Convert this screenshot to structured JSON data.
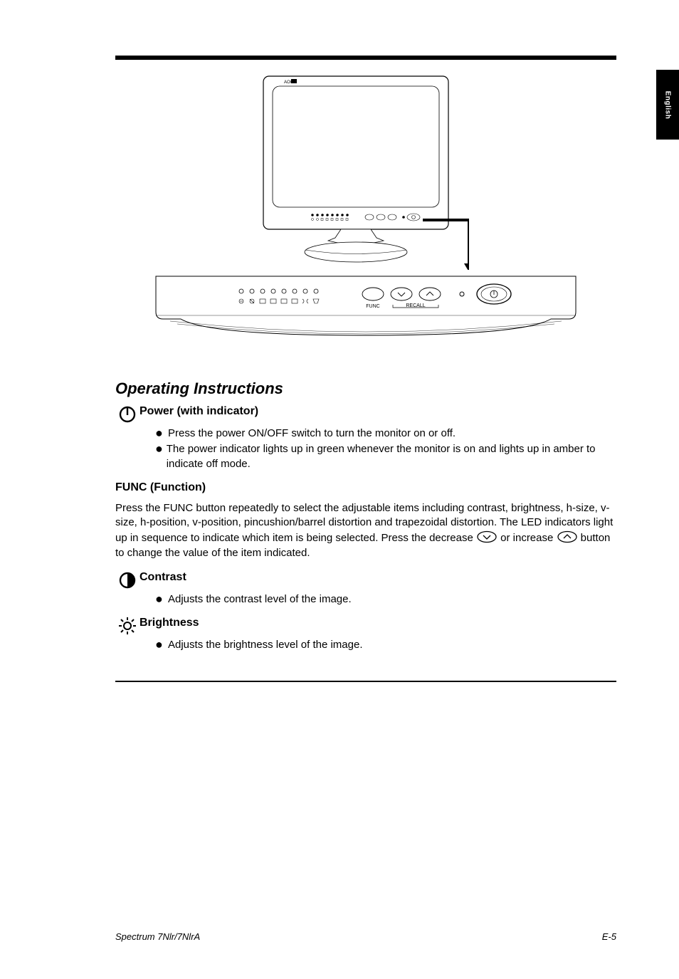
{
  "sidebar": {
    "label": "English"
  },
  "figure": {
    "monitor_brand": "AOC",
    "panel_label_func": "FUNC",
    "panel_label_recall": "RECALL"
  },
  "sections": {
    "operating": {
      "heading": "Operating Instructions",
      "power_label": "Power (with indicator)",
      "bullets": [
        "Press the power ON/OFF switch to turn the monitor on or off.",
        "The power indicator lights up in green whenever the monitor is on and lights up in amber to indicate off mode."
      ],
      "func_label": "FUNC (Function)",
      "func_para": "Press the FUNC button repeatedly to select the adjustable items including contrast, brightness, h-size, v-size, h-position, v-position, pincushion/barrel distortion and trapezoidal distortion. The LED indicators light up in sequence to indicate which item is being selected. Press the decrease   or increase   button to change the value of the item indicated.",
      "contrast_label": "Contrast",
      "contrast_bullet": "Adjusts the contrast level of the image.",
      "brightness_label": "Brightness",
      "brightness_bullet": "Adjusts the brightness level of the image."
    }
  },
  "footer": {
    "title": "Spectrum 7Nlr/7NlrA",
    "page": "E-5"
  }
}
